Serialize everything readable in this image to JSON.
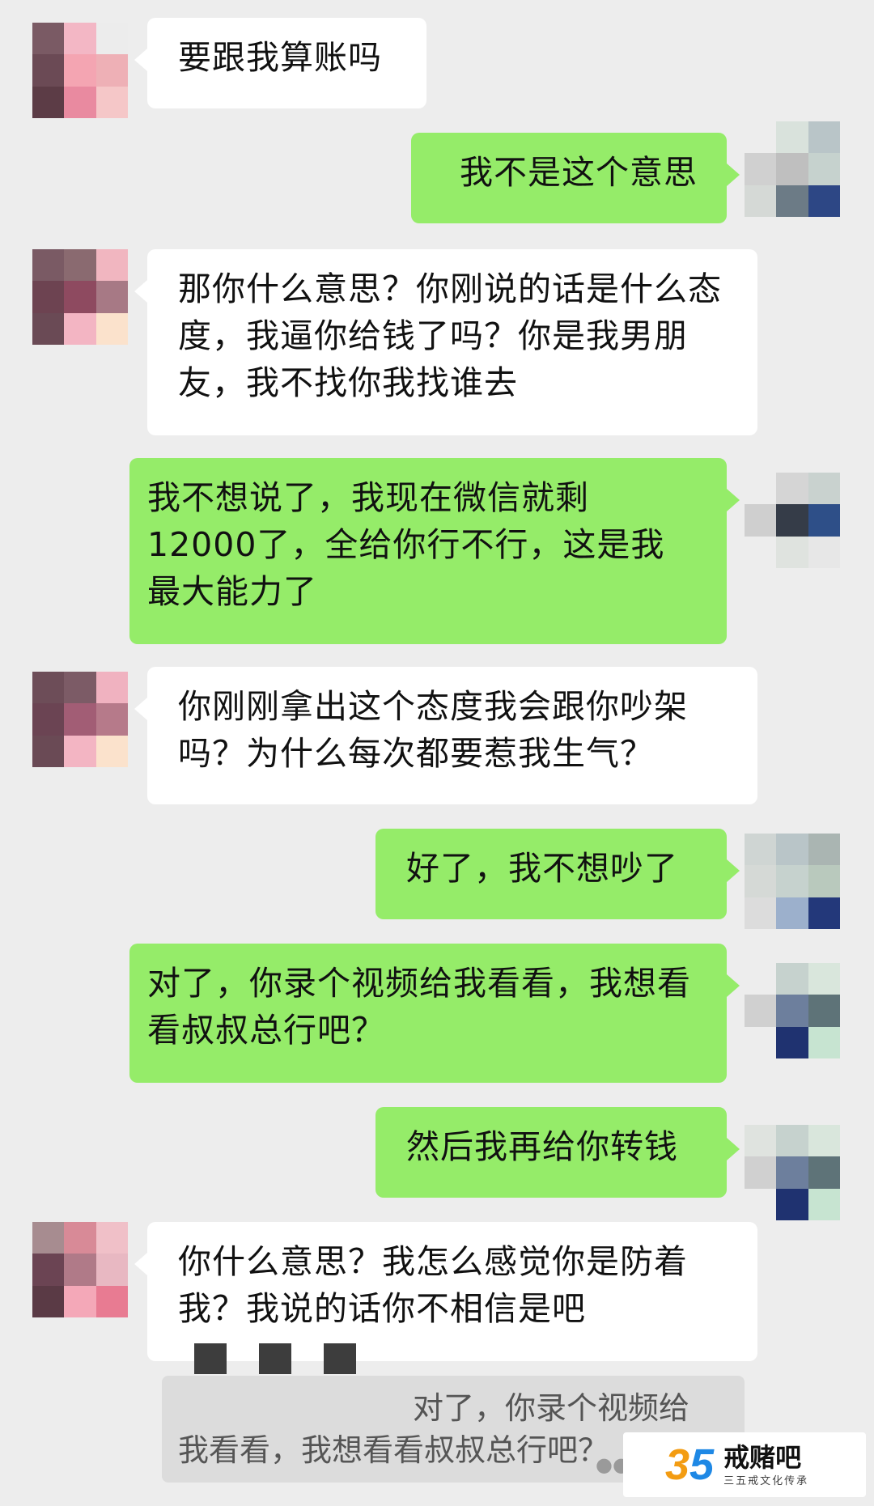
{
  "messages": [
    {
      "side": "in",
      "text": "要跟我算账吗",
      "avatar": "woman"
    },
    {
      "side": "out",
      "text": "我不是这个意思",
      "avatar": "man"
    },
    {
      "side": "in",
      "text": "那你什么意思？你刚说的话是什么态度，我逼你给钱了吗？你是我男朋友，我不找你我找谁去",
      "avatar": "woman"
    },
    {
      "side": "out",
      "text": "我不想说了，我现在微信就剩12000了，全给你行不行，这是我最大能力了",
      "avatar": "man"
    },
    {
      "side": "in",
      "text": "你刚刚拿出这个态度我会跟你吵架吗？为什么每次都要惹我生气？",
      "avatar": "woman"
    },
    {
      "side": "out",
      "text": "好了，我不想吵了",
      "avatar": "man"
    },
    {
      "side": "out",
      "text": "对了，你录个视频给我看看，我想看看叔叔总行吧？",
      "avatar": "man"
    },
    {
      "side": "out",
      "text": "然后我再给你转钱",
      "avatar": "man"
    },
    {
      "side": "in",
      "text": "你什么意思？我怎么感觉你是防着我？我说的话你不相信是吧",
      "avatar": "woman"
    }
  ],
  "quote": {
    "line1": "对了，你录个视频给",
    "line2": "我看看，我想看看叔叔总行吧？"
  },
  "watermark": {
    "number_a": "3",
    "number_b": "5",
    "title": "戒赌吧",
    "subtitle": "三五戒文化传承"
  },
  "colors": {
    "background": "#ededed",
    "incoming_bubble": "#ffffff",
    "outgoing_bubble": "#95ec69"
  }
}
